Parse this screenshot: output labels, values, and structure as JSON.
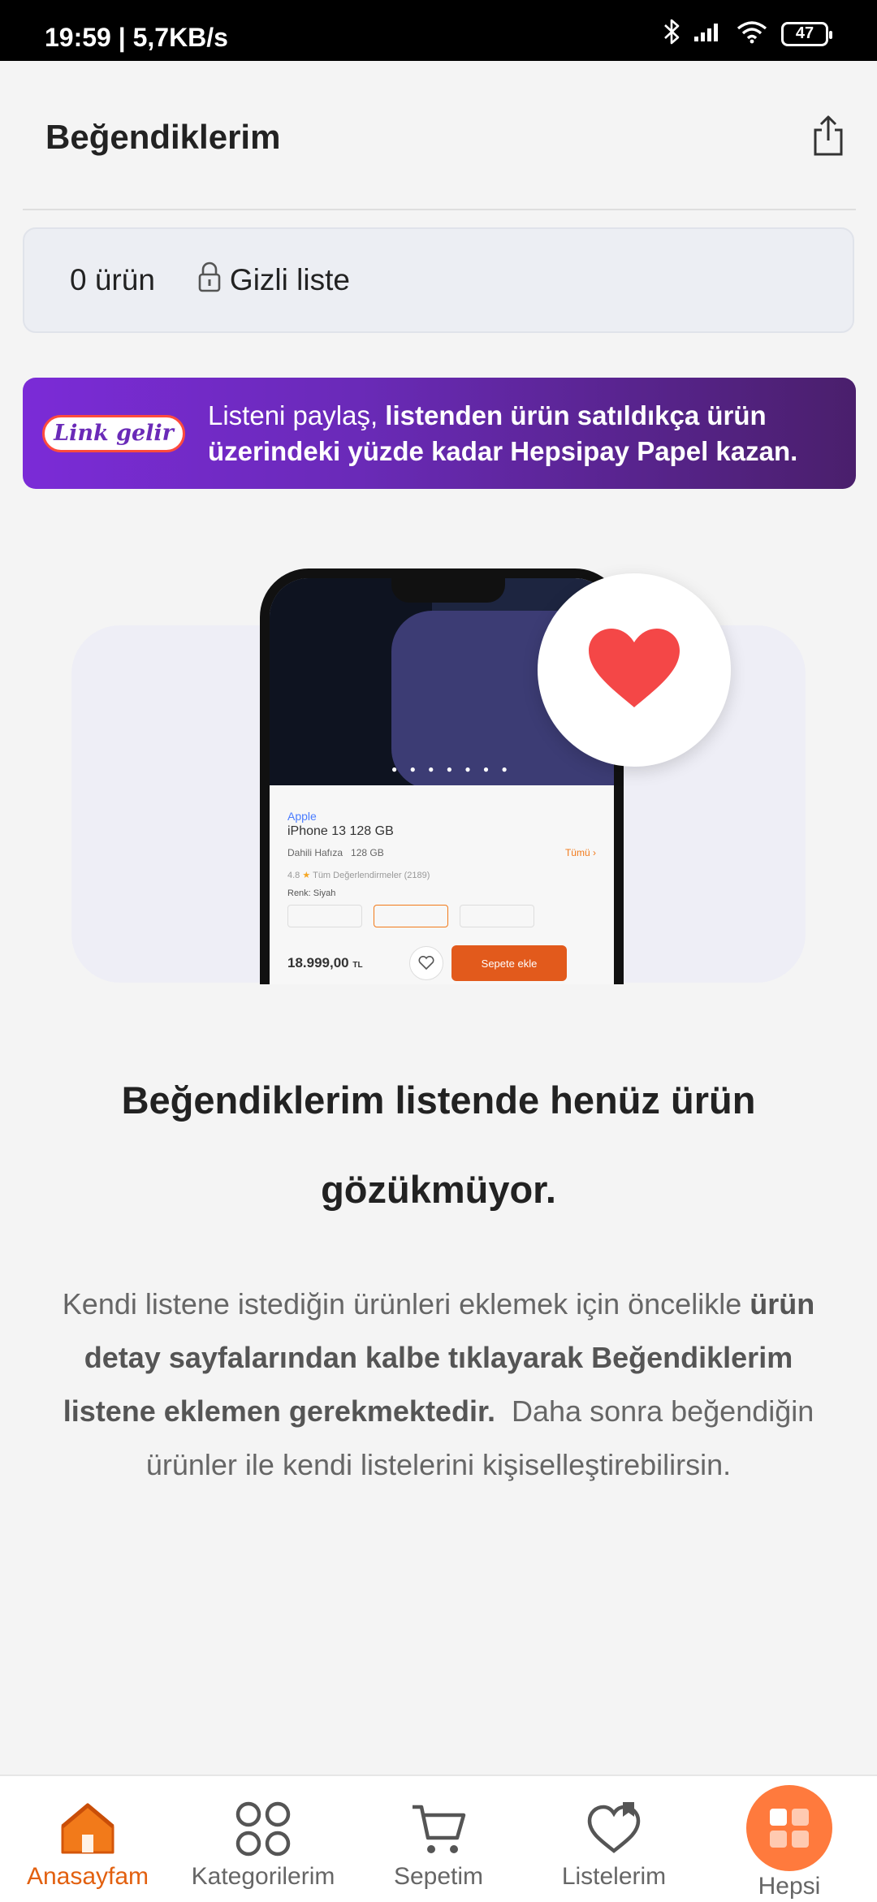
{
  "status_bar": {
    "time": "19:59 | 5,7KB/s",
    "battery": "47",
    "icons": [
      "bluetooth-icon",
      "signal-icon",
      "wifi-icon",
      "battery-icon"
    ]
  },
  "header": {
    "title": "Beğendiklerim",
    "share_icon": "share-icon"
  },
  "list_info": {
    "count": "0 ürün",
    "privacy": "Gizli liste",
    "lock_icon": "lock-icon"
  },
  "promo": {
    "logo": "Link gelir",
    "text_normal": "Listeni paylaş,",
    "text_bold": "listenden ürün satıldıkça ürün üzerindeki yüzde kadar Hepsipay Papel kazan."
  },
  "illustration": {
    "brand": "Apple",
    "product": "iPhone 13 128 GB",
    "storage_label": "Dahili Hafıza",
    "storage_value": "128 GB",
    "all_label": "Tümü",
    "rating": "4.8",
    "rating_text": "Tüm Değerlendirmeler (2189)",
    "color_label": "Renk: Siyah",
    "price": "18.999,00",
    "currency": "TL",
    "cart_button": "Sepete ekle",
    "heart_color": "#f44747"
  },
  "empty_state": {
    "title": "Beğendiklerim listende henüz ürün gözükmüyor.",
    "desc_part1": "Kendi listene istediğin ürünleri eklemek için öncelikle",
    "desc_bold": "ürün detay sayfalarından kalbe tıklayarak Beğendiklerim listene eklemen gerekmektedir.",
    "desc_part2": "Daha sonra beğendiğin ürünler ile kendi listelerini kişiselleştirebilirsin."
  },
  "bottom_nav": {
    "items": [
      {
        "label": "Anasayfam",
        "icon": "home-icon",
        "active": true
      },
      {
        "label": "Kategorilerim",
        "icon": "categories-icon",
        "active": false
      },
      {
        "label": "Sepetim",
        "icon": "cart-icon",
        "active": false
      },
      {
        "label": "Listelerim",
        "icon": "lists-heart-icon",
        "active": false
      },
      {
        "label": "Hepsi",
        "icon": "hepsi-grid-icon",
        "active": false
      }
    ]
  },
  "colors": {
    "accent_orange": "#e2600f",
    "promo_purple": "#6a2ab8"
  }
}
